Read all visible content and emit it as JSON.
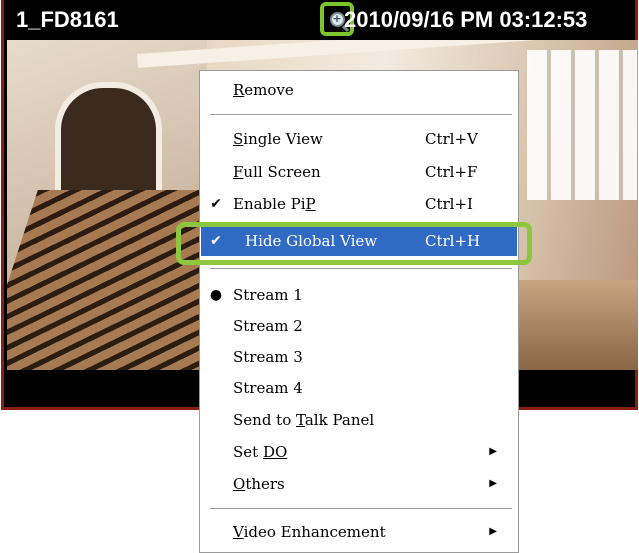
{
  "camera": {
    "name": "1_FD8161",
    "timestamp": "2010/09/16 PM 03:12:53",
    "zoom_icon": "magnifier-zoom-icon"
  },
  "context_menu": {
    "items": [
      {
        "label": "Remove",
        "accel": "R",
        "shortcut": "",
        "checked": false,
        "bullet": false,
        "submenu": false
      },
      {
        "label": "Single View",
        "accel": "S",
        "shortcut": "Ctrl+V",
        "checked": false,
        "bullet": false,
        "submenu": false
      },
      {
        "label": "Full Screen",
        "accel": "F",
        "shortcut": "Ctrl+F",
        "checked": false,
        "bullet": false,
        "submenu": false
      },
      {
        "label": "Enable PiP",
        "accel": "P",
        "shortcut": "Ctrl+I",
        "checked": true,
        "bullet": false,
        "submenu": false
      },
      {
        "label": "Hide Global View",
        "accel": "",
        "shortcut": "Ctrl+H",
        "checked": true,
        "bullet": false,
        "submenu": false,
        "selected": true
      },
      {
        "label": "Stream 1",
        "accel": "",
        "shortcut": "",
        "checked": false,
        "bullet": true,
        "submenu": false
      },
      {
        "label": "Stream 2",
        "accel": "",
        "shortcut": "",
        "checked": false,
        "bullet": false,
        "submenu": false
      },
      {
        "label": "Stream 3",
        "accel": "",
        "shortcut": "",
        "checked": false,
        "bullet": false,
        "submenu": false
      },
      {
        "label": "Stream 4",
        "accel": "",
        "shortcut": "",
        "checked": false,
        "bullet": false,
        "submenu": false
      },
      {
        "label": "Send to Talk Panel",
        "accel": "T",
        "shortcut": "",
        "checked": false,
        "bullet": false,
        "submenu": false
      },
      {
        "label": "Set DO",
        "accel": "DO",
        "shortcut": "",
        "checked": false,
        "bullet": false,
        "submenu": true
      },
      {
        "label": "Others",
        "accel": "O",
        "shortcut": "",
        "checked": false,
        "bullet": false,
        "submenu": true
      },
      {
        "label": "Video Enhancement",
        "accel": "V",
        "shortcut": "",
        "checked": false,
        "bullet": false,
        "submenu": true
      }
    ],
    "check_glyph": "✔",
    "bullet_glyph": "●",
    "arrow_glyph": "▶"
  },
  "colors": {
    "selection": "#316ac5",
    "highlight_frame": "#8dc63f",
    "panel_border": "#8a1e12"
  }
}
